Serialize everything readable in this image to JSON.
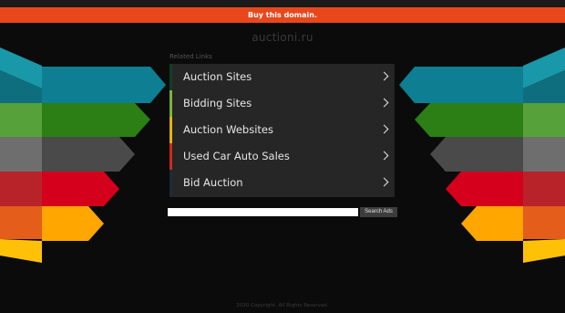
{
  "topbar": {
    "buy_label": "Buy this domain."
  },
  "domain": "auctioni.ru",
  "related": {
    "label": "Related Links",
    "links": [
      {
        "label": "Auction Sites",
        "color": "#0e3f2b"
      },
      {
        "label": "Bidding Sites",
        "color": "#7fb531"
      },
      {
        "label": "Auction Websites",
        "color": "#e5b400"
      },
      {
        "label": "Used Car Auto Sales",
        "color": "#d0281a"
      },
      {
        "label": "Bid Auction",
        "color": "#1f2a36"
      }
    ]
  },
  "search": {
    "button_label": "Search Ads",
    "value": ""
  },
  "footer": {
    "text": "2020 Copyright. All Rights Reserved."
  },
  "colors": {
    "accent": "#e8471c",
    "stripes": [
      "#1898a8",
      "#117a8c",
      "#2c8a37",
      "#2f7a1c",
      "#6c6c6c",
      "#474747",
      "#c0242c",
      "#d9001a",
      "#e8611a",
      "#ffa600",
      "#ffc107"
    ]
  }
}
